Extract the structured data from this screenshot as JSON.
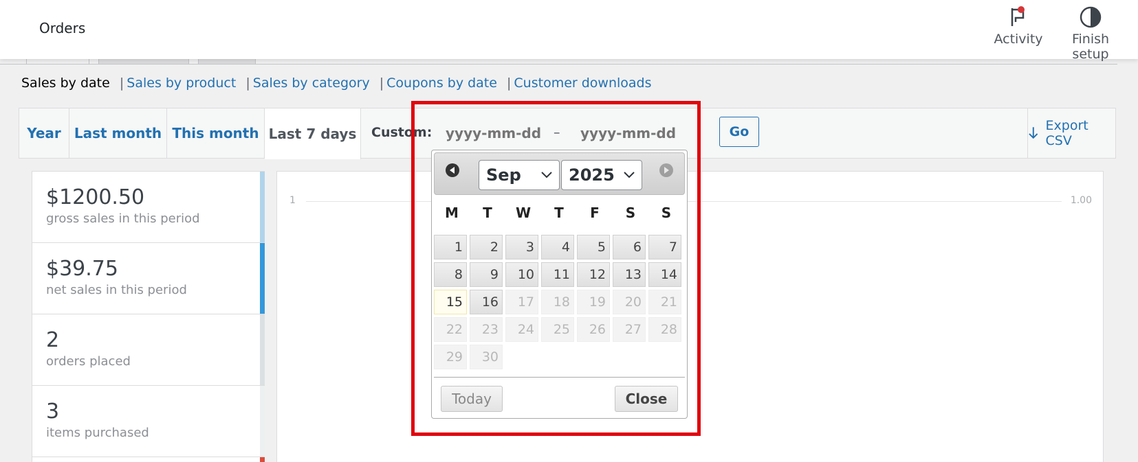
{
  "header": {
    "title": "Orders",
    "actions": [
      {
        "label": "Activity",
        "icon": "flag-icon"
      },
      {
        "label": "Finish setup",
        "icon": "half-circle-icon"
      }
    ]
  },
  "report_links": {
    "current": "Sales by date",
    "links": [
      "Sales by product",
      "Sales by category",
      "Coupons by date",
      "Customer downloads"
    ],
    "separator": "|"
  },
  "range_bar": {
    "tabs": [
      "Year",
      "Last month",
      "This month",
      "Last 7 days"
    ],
    "active_tab": "Last 7 days",
    "custom_label": "Custom:",
    "start_placeholder": "yyyy-mm-dd",
    "end_placeholder": "yyyy-mm-dd",
    "dash": "–",
    "go_label": "Go",
    "export_label": "Export CSV"
  },
  "legend": [
    {
      "amount": "$1200.50",
      "desc": "gross sales in this period",
      "color": "#b1d4ea"
    },
    {
      "amount": "$39.75",
      "desc": "net sales in this period",
      "color": "#3498db"
    },
    {
      "amount": "2",
      "desc": "orders placed",
      "color": "#dbe1e3"
    },
    {
      "amount": "3",
      "desc": "items purchased",
      "color": "#ecf0f1"
    }
  ],
  "chart": {
    "y_left_tick": "1",
    "y_right_tick": "1.00"
  },
  "datepicker": {
    "month": "Sep",
    "year": "2025",
    "weekdays": [
      "M",
      "T",
      "W",
      "T",
      "F",
      "S",
      "S"
    ],
    "today": "15",
    "days": [
      "1",
      "2",
      "3",
      "4",
      "5",
      "6",
      "7",
      "8",
      "9",
      "10",
      "11",
      "12",
      "13",
      "14",
      "15",
      "16",
      "17",
      "18",
      "19",
      "20",
      "21",
      "22",
      "23",
      "24",
      "25",
      "26",
      "27",
      "28",
      "29",
      "30"
    ],
    "last_enabled_day": 16,
    "today_button": "Today",
    "close_button": "Close"
  },
  "colors": {
    "accent": "#2271b1",
    "highlight": "#e0050f"
  }
}
